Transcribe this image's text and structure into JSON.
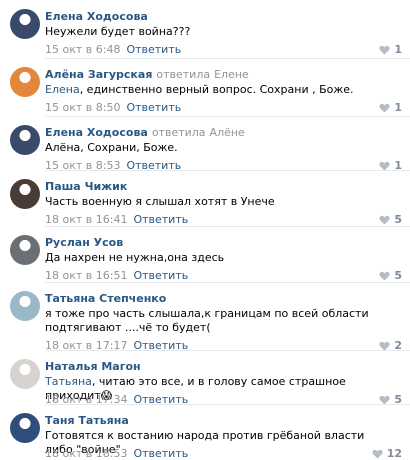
{
  "comments": [
    {
      "author": "Елена Ходосова",
      "reply_action": "",
      "reply_to": "",
      "mention": "",
      "text": "Неужели будет война???",
      "date": "15 окт в 6:48",
      "reply_label": "Ответить",
      "likes": "1",
      "avatar_color": "#3a4a6b"
    },
    {
      "author": "Алёна Загурская",
      "reply_action": "ответила",
      "reply_to": "Елене",
      "mention": "Елена",
      "text": ", единственно верный вопрос. Сохрани , Боже.",
      "date": "15 окт в 8:50",
      "reply_label": "Ответить",
      "likes": "1",
      "avatar_color": "#e3873a"
    },
    {
      "author": "Елена Ходосова",
      "reply_action": "ответила",
      "reply_to": "Алёне",
      "mention": "",
      "text": "Алёна, Сохрани, Боже.",
      "date": "15 окт в 8:53",
      "reply_label": "Ответить",
      "likes": "1",
      "avatar_color": "#3a4a6b"
    },
    {
      "author": "Паша Чижик",
      "reply_action": "",
      "reply_to": "",
      "mention": "",
      "text": "Часть военную я слышал хотят в Унече",
      "date": "18 окт в 16:41",
      "reply_label": "Ответить",
      "likes": "5",
      "avatar_color": "#4a3b35"
    },
    {
      "author": "Руслан Усов",
      "reply_action": "",
      "reply_to": "",
      "mention": "",
      "text": "Да нахрен не нужна,она здесь",
      "date": "18 окт в 16:51",
      "reply_label": "Ответить",
      "likes": "5",
      "avatar_color": "#6b6f74"
    },
    {
      "author": "Татьяна Степченко",
      "reply_action": "",
      "reply_to": "",
      "mention": "",
      "text": "я тоже про часть слышала,к границам по всей области подтягивают ....чё то будет(",
      "date": "18 окт в 17:17",
      "reply_label": "Ответить",
      "likes": "2",
      "avatar_color": "#9ab8c7"
    },
    {
      "author": "Наталья Магон",
      "reply_action": "",
      "reply_to": "",
      "mention": "Татьяна",
      "text": ", читаю это все, и в голову самое страшное приходит😱",
      "date": "18 окт в 17:34",
      "reply_label": "Ответить",
      "likes": "5",
      "avatar_color": "#d7d3cf"
    },
    {
      "author": "Таня Татьяна",
      "reply_action": "",
      "reply_to": "",
      "mention": "",
      "text": "Готовятся к востанию народа против грёбаной власти либо \"войне\"",
      "date": "18 окт в 18:53",
      "reply_label": "Ответить",
      "likes": "12",
      "avatar_color": "#2f4f7a"
    }
  ],
  "icons": {
    "like": "heart-icon"
  },
  "colors": {
    "link": "#2a5885",
    "muted": "#939393"
  }
}
